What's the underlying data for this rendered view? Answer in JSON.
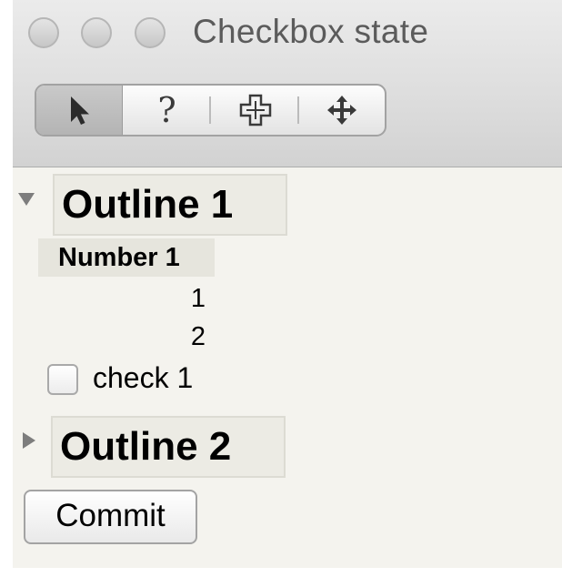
{
  "window": {
    "title": "Checkbox state"
  },
  "toolbar": {
    "tools": [
      {
        "name": "pointer-tool",
        "icon": "arrow-pointer-icon",
        "selected": true
      },
      {
        "name": "help-tool",
        "icon": "question-mark-icon",
        "label": "?",
        "selected": false
      },
      {
        "name": "crosshair-tool",
        "icon": "plus-crosshair-icon",
        "selected": false
      },
      {
        "name": "move-tool",
        "icon": "four-way-arrow-icon",
        "selected": false
      }
    ]
  },
  "outline1": {
    "title": "Outline 1",
    "expanded": true,
    "column_header": "Number 1",
    "rows": [
      "1",
      "2"
    ],
    "checkbox": {
      "label": "check 1",
      "checked": false
    }
  },
  "outline2": {
    "title": "Outline 2",
    "expanded": false
  },
  "commit_button": {
    "label": "Commit"
  }
}
